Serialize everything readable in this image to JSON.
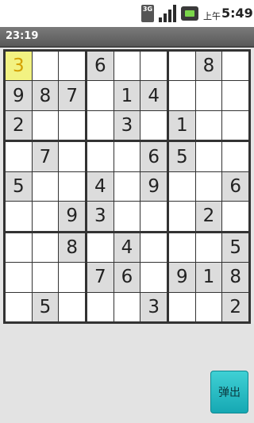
{
  "status_bar": {
    "network_badge": "3G",
    "ampm": "上午",
    "time": "5:49",
    "icons": [
      "network-3g-icon",
      "signal-strength-icon",
      "battery-icon"
    ]
  },
  "timer": "23:19",
  "grid": [
    [
      "3",
      "",
      "",
      "6",
      "",
      "",
      "",
      "8",
      ""
    ],
    [
      "9",
      "8",
      "7",
      "",
      "1",
      "4",
      "",
      "",
      ""
    ],
    [
      "2",
      "",
      "",
      "",
      "3",
      "",
      "1",
      "",
      ""
    ],
    [
      "",
      "7",
      "",
      "",
      "",
      "6",
      "5",
      "",
      ""
    ],
    [
      "5",
      "",
      "",
      "4",
      "",
      "9",
      "",
      "",
      "6"
    ],
    [
      "",
      "",
      "9",
      "3",
      "",
      "",
      "",
      "2",
      ""
    ],
    [
      "",
      "",
      "8",
      "",
      "4",
      "",
      "",
      "",
      "5"
    ],
    [
      "",
      "",
      "",
      "7",
      "6",
      "",
      "9",
      "1",
      "8"
    ],
    [
      "",
      "5",
      "",
      "",
      "",
      "3",
      "",
      "",
      "2"
    ]
  ],
  "given_cells": [
    [
      0,
      3
    ],
    [
      0,
      7
    ],
    [
      1,
      0
    ],
    [
      1,
      1
    ],
    [
      1,
      2
    ],
    [
      1,
      4
    ],
    [
      1,
      5
    ],
    [
      2,
      0
    ],
    [
      2,
      4
    ],
    [
      2,
      6
    ],
    [
      3,
      1
    ],
    [
      3,
      5
    ],
    [
      3,
      6
    ],
    [
      4,
      0
    ],
    [
      4,
      3
    ],
    [
      4,
      5
    ],
    [
      4,
      8
    ],
    [
      5,
      2
    ],
    [
      5,
      3
    ],
    [
      5,
      7
    ],
    [
      6,
      2
    ],
    [
      6,
      4
    ],
    [
      6,
      8
    ],
    [
      7,
      3
    ],
    [
      7,
      4
    ],
    [
      7,
      6
    ],
    [
      7,
      7
    ],
    [
      7,
      8
    ],
    [
      8,
      1
    ],
    [
      8,
      5
    ],
    [
      8,
      8
    ]
  ],
  "selected_cell": [
    0,
    0
  ],
  "colors": {
    "given_bg": "#dcdcdc",
    "empty_bg": "#ffffff",
    "selected_bg": "#f2f282",
    "selected_text": "#d4a000"
  },
  "popup_button_label": "弹出"
}
